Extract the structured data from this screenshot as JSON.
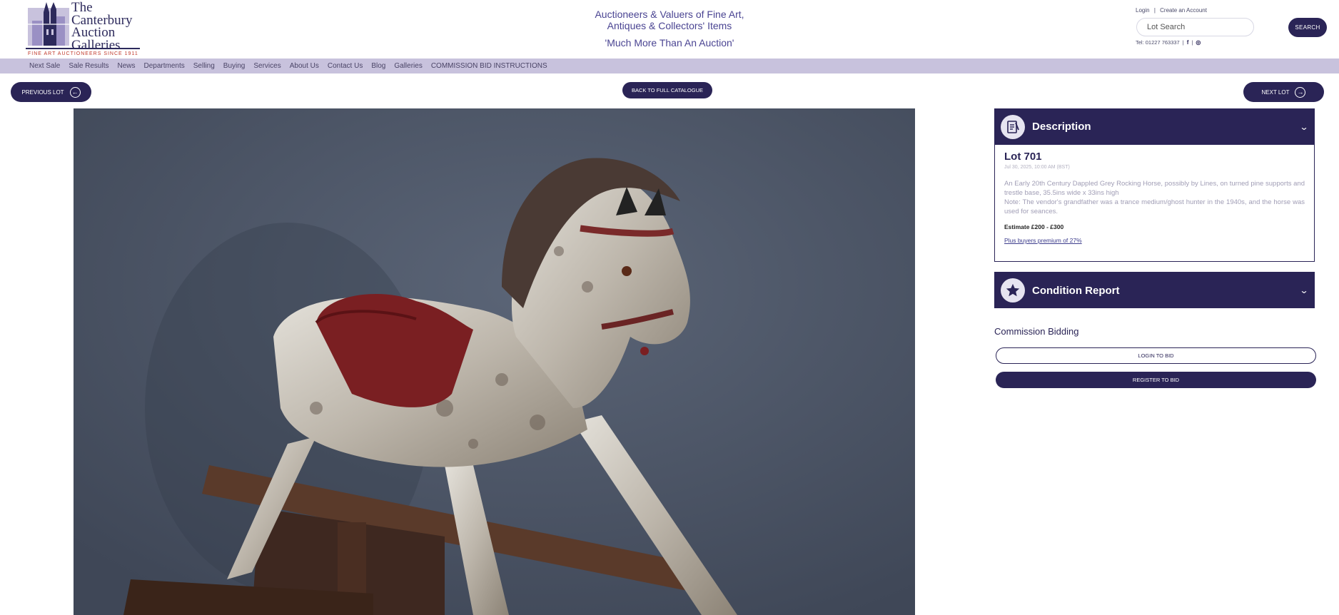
{
  "brand": {
    "logo_text": [
      "The",
      "Canterbury",
      "Auction",
      "Galleries"
    ],
    "logo_tagline": "FINE ART AUCTIONEERS SINCE 1911",
    "accent": "#2a2456",
    "nav_bg": "#c8c2dd"
  },
  "tagline": {
    "line1": "Auctioneers & Valuers of Fine Art,",
    "line2": "Antiques & Collectors' Items",
    "slogan": "'Much More Than An Auction'"
  },
  "account": {
    "login": "Login",
    "separator": "|",
    "create": "Create an Account"
  },
  "search": {
    "placeholder": "Lot Search",
    "button": "SEARCH"
  },
  "contact": {
    "phone": "Tel: 01227 763337",
    "separator": "|",
    "social_icons": [
      "facebook-icon",
      "instagram-icon"
    ]
  },
  "nav": {
    "items": [
      "Next Sale",
      "Sale Results",
      "News",
      "Departments",
      "Selling",
      "Buying",
      "Services",
      "About Us",
      "Contact Us",
      "Blog",
      "Galleries",
      "COMMISSION BID INSTRUCTIONS"
    ]
  },
  "lot_nav": {
    "previous": "PREVIOUS LOT",
    "back": "BACK TO FULL CATALOGUE",
    "next": "NEXT LOT"
  },
  "description": {
    "heading": "Description",
    "lot_title": "Lot 701",
    "date": "Jul 30, 2025, 10:00 AM (BST)",
    "text_1": "An Early 20th Century Dappled Grey Rocking Horse, possibly by Lines, on turned pine supports and trestle base, 35.5ins wide x 33ins high",
    "text_2": "Note: The vendor's grandfather was a trance medium/ghost hunter in the 1940s, and the horse was used for seances.",
    "estimate": "Estimate £200 - £300",
    "premium": "Plus buyers premium of 27%"
  },
  "condition": {
    "heading": "Condition Report"
  },
  "bidding": {
    "heading": "Commission Bidding",
    "login": "LOGIN TO BID",
    "register": "REGISTER TO BID"
  }
}
